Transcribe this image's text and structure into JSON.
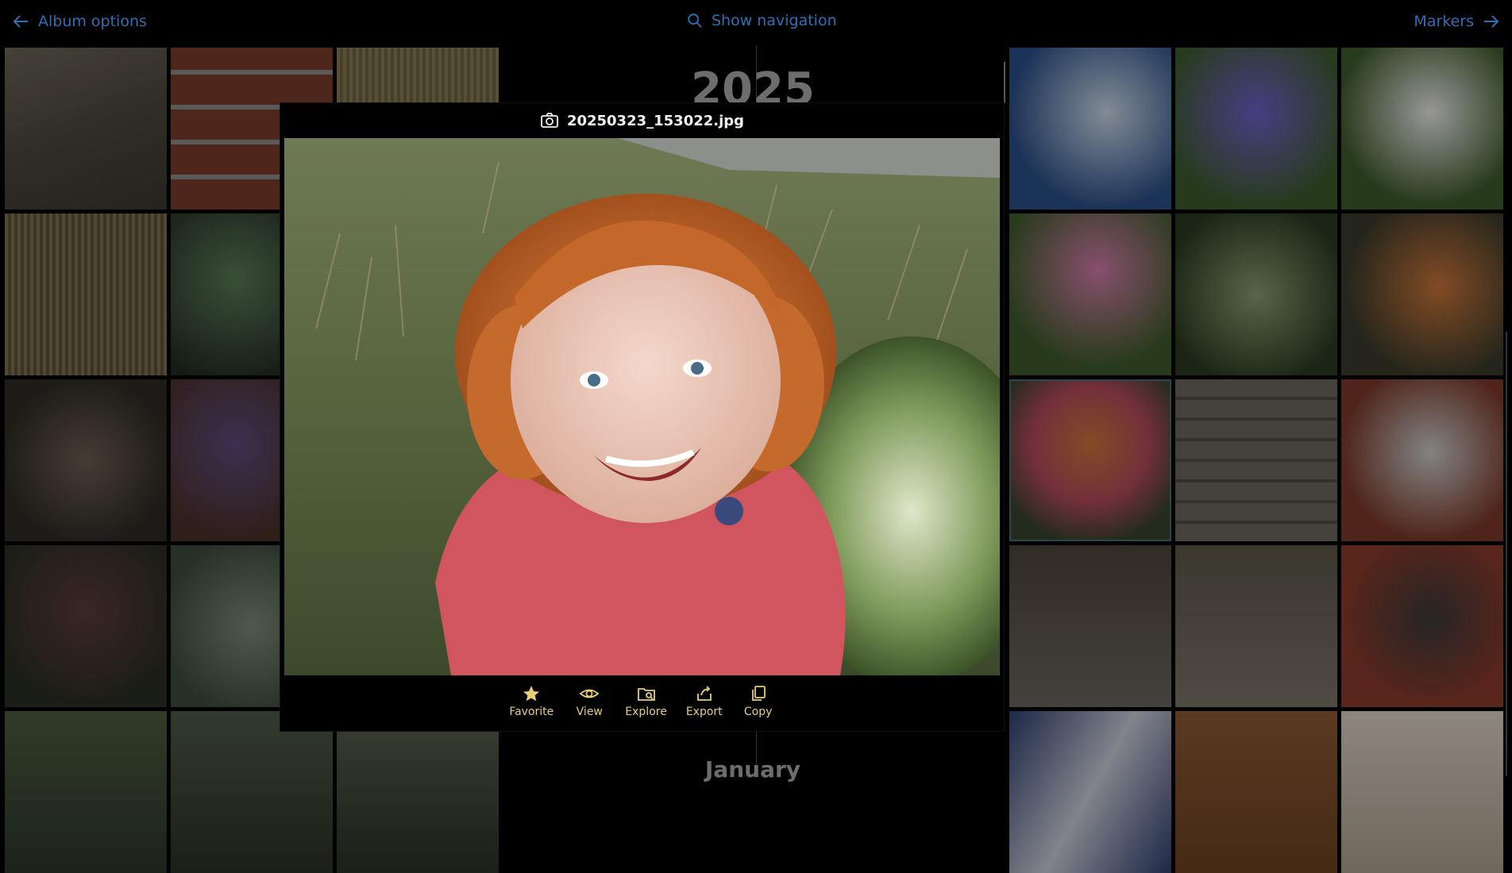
{
  "topbar": {
    "left_label": "Album options",
    "center_label": "Show navigation",
    "right_label": "Markers"
  },
  "timeline": {
    "year": "2025",
    "month": "January"
  },
  "preview": {
    "filename": "20250323_153022.jpg",
    "actions": [
      {
        "label": "Favorite",
        "icon": "star-icon"
      },
      {
        "label": "View",
        "icon": "eye-icon"
      },
      {
        "label": "Explore",
        "icon": "folder-search-icon"
      },
      {
        "label": "Export",
        "icon": "share-icon"
      },
      {
        "label": "Copy",
        "icon": "copy-icon"
      }
    ]
  },
  "colors": {
    "link": "#2f6fb3",
    "action": "#e7cf73",
    "selected_outline": "#3d6f7a"
  }
}
